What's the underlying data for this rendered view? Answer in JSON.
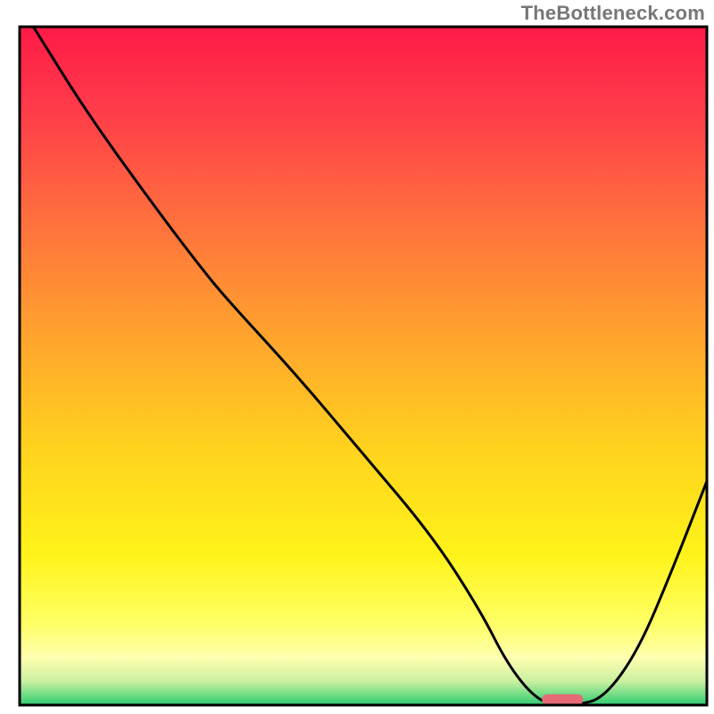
{
  "watermark": "TheBottleneck.com",
  "chart_data": {
    "type": "line",
    "title": "",
    "xlabel": "",
    "ylabel": "",
    "xlim": [
      0,
      100
    ],
    "ylim": [
      0,
      100
    ],
    "grid": false,
    "series": [
      {
        "name": "bottleneck-curve",
        "x": [
          2,
          10,
          20,
          26,
          30,
          40,
          50,
          60,
          67,
          71,
          75,
          78,
          81,
          85,
          90,
          95,
          100
        ],
        "y": [
          100,
          87,
          73,
          65,
          60,
          49,
          37,
          25,
          14,
          6,
          1,
          0,
          0,
          1,
          8,
          20,
          33
        ]
      }
    ],
    "marker": {
      "name": "optimal-range-marker",
      "x_center": 79,
      "y": 0.8,
      "width": 6,
      "height": 1.6,
      "color": "#e46a76"
    },
    "background_gradient_stops": [
      {
        "offset": 0.0,
        "color": "#ff1a47"
      },
      {
        "offset": 0.12,
        "color": "#ff3b4a"
      },
      {
        "offset": 0.28,
        "color": "#ff6e3e"
      },
      {
        "offset": 0.45,
        "color": "#ffa22e"
      },
      {
        "offset": 0.62,
        "color": "#ffd21e"
      },
      {
        "offset": 0.78,
        "color": "#fff31a"
      },
      {
        "offset": 0.88,
        "color": "#ffff66"
      },
      {
        "offset": 0.93,
        "color": "#ffffb0"
      },
      {
        "offset": 0.965,
        "color": "#c9f0a0"
      },
      {
        "offset": 1.0,
        "color": "#2ecc71"
      }
    ]
  }
}
